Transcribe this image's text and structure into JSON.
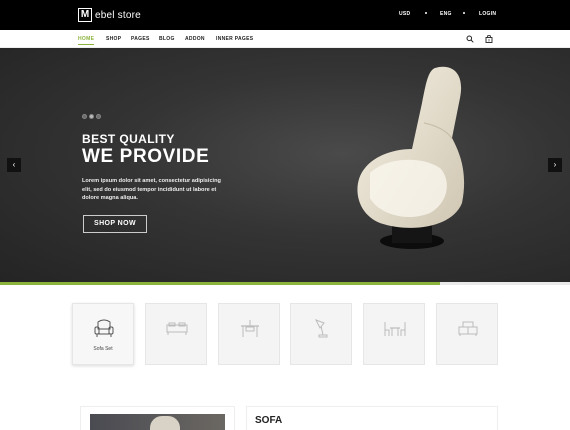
{
  "topbar": {
    "logo_mark": "M",
    "logo_text": "ebel store",
    "currency": "USD",
    "language": "ENG",
    "login": "LOGIN"
  },
  "nav": {
    "items": [
      "HOME",
      "SHOP",
      "PAGES",
      "BLOG",
      "ADDON",
      "INNER PAGES"
    ],
    "active": "HOME"
  },
  "hero": {
    "kicker": "BEST QUALITY",
    "headline": "WE PROVIDE",
    "copy": "Lorem ipsum dolor sit amet, consectetur adipisicing elit, sed do eiusmod tempor incididunt ut labore et dolore magna aliqua.",
    "button": "SHOP NOW",
    "prev": "‹",
    "next": "›",
    "slides": 3,
    "active_slide": 2
  },
  "categories": [
    {
      "label": "Sofa Set",
      "icon": "armchair-icon",
      "active": true
    },
    {
      "label": "",
      "icon": "bed-icon",
      "active": false
    },
    {
      "label": "",
      "icon": "desk-icon",
      "active": false
    },
    {
      "label": "",
      "icon": "lamp-icon",
      "active": false
    },
    {
      "label": "",
      "icon": "dining-table-icon",
      "active": false
    },
    {
      "label": "",
      "icon": "tv-stand-icon",
      "active": false
    }
  ],
  "featured": {
    "title": "SOFA"
  },
  "colors": {
    "accent": "#8cb43c",
    "topbar": "#000000",
    "hero_bg": "#343434"
  }
}
